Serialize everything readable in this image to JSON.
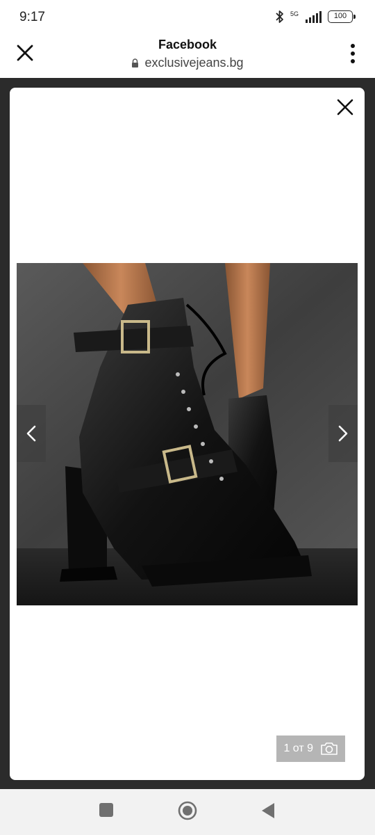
{
  "status_bar": {
    "time": "9:17",
    "network": "5G",
    "battery": "100",
    "icons": [
      "bluetooth-icon",
      "signal-icon",
      "battery-icon"
    ]
  },
  "browser": {
    "title": "Facebook",
    "url": "exclusivejeans.bg",
    "icons": [
      "close-icon",
      "lock-icon",
      "more-vertical-icon"
    ]
  },
  "gallery": {
    "counter": "1 от 9",
    "icons": [
      "close-icon",
      "chevron-left-icon",
      "chevron-right-icon",
      "camera-icon"
    ]
  },
  "colors": {
    "dim_overlay": "#2b2b2b",
    "modal_bg": "#ffffff",
    "nav_bar_bg": "#f2f2f2"
  },
  "system_nav": {
    "icons": [
      "recent-apps-icon",
      "home-icon",
      "back-icon"
    ]
  }
}
